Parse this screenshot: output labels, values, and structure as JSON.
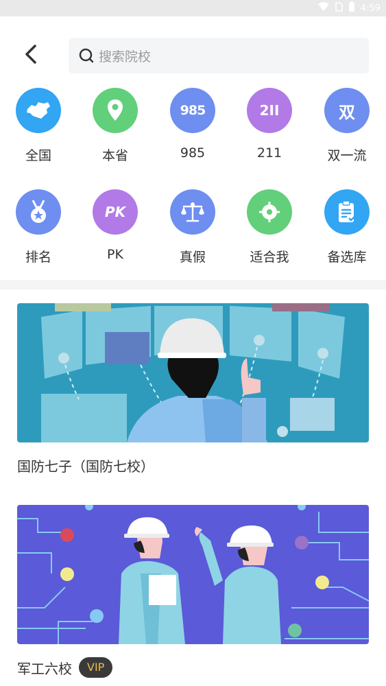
{
  "status_bar": {
    "time": "4:59"
  },
  "search": {
    "placeholder": "搜索院校"
  },
  "categories": [
    {
      "label": "全国",
      "icon": "china-map-icon",
      "color": "#32a5f3"
    },
    {
      "label": "本省",
      "icon": "location-pin-icon",
      "color": "#62cf7a"
    },
    {
      "label": "985",
      "icon": "985-icon",
      "badge": "985",
      "color": "#6e8ef0"
    },
    {
      "label": "211",
      "icon": "211-icon",
      "badge": "2II",
      "color": "#b27ae6"
    },
    {
      "label": "双一流",
      "icon": "double-first-class-icon",
      "badge": "双",
      "color": "#6e8ef0"
    },
    {
      "label": "排名",
      "icon": "medal-icon",
      "color": "#6e8ef0"
    },
    {
      "label": "PK",
      "icon": "pk-icon",
      "badge": "PK",
      "color": "#b27ae6"
    },
    {
      "label": "真假",
      "icon": "scales-icon",
      "color": "#6e8ef0"
    },
    {
      "label": "适合我",
      "icon": "target-icon",
      "color": "#62cf7a"
    },
    {
      "label": "备选库",
      "icon": "clipboard-icon",
      "color": "#32a5f3"
    }
  ],
  "cards": [
    {
      "title": "国防七子（国防七校）",
      "vip": null
    },
    {
      "title": "军工六校",
      "vip": "VIP"
    }
  ]
}
